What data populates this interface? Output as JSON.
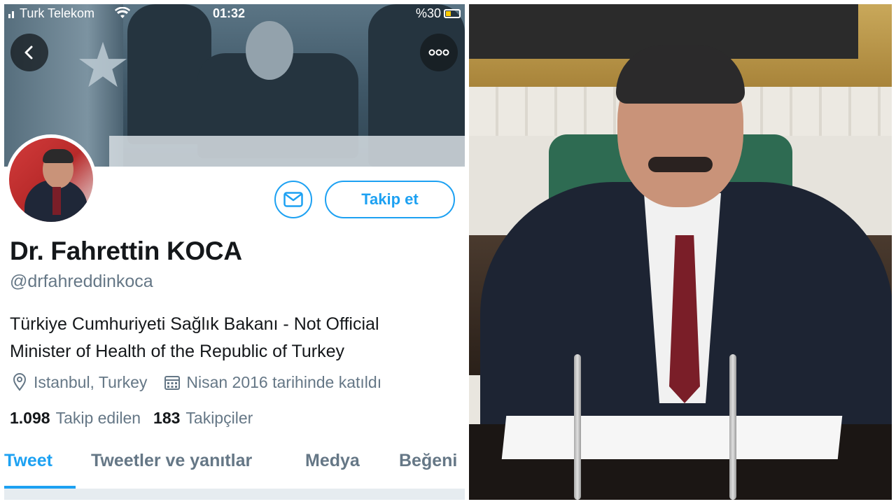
{
  "status_bar": {
    "carrier": "Turk Telekom",
    "time": "01:32",
    "battery": "%30"
  },
  "profile": {
    "name": "Dr. Fahrettin KOCA",
    "handle": "@drfahreddinkoca",
    "bio_line1": "Türkiye Cumhuriyeti Sağlık Bakanı - Not Official",
    "bio_line2": "Minister of Health of the Republic of Turkey",
    "location": "Istanbul, Turkey",
    "joined": "Nisan 2016 tarihinde katıldı",
    "following_count": "1.098",
    "following_label": "Takip edilen",
    "followers_count": "183",
    "followers_label": "Takipçiler",
    "follow_button": "Takip et"
  },
  "tabs": [
    {
      "label": "Tweet",
      "active": true
    },
    {
      "label": "Tweetler ve yanıtlar",
      "active": false
    },
    {
      "label": "Medya",
      "active": false
    },
    {
      "label": "Beğeni",
      "active": false
    }
  ],
  "icons": {
    "back": "back-arrow-icon",
    "more": "more-options-icon",
    "message": "envelope-icon",
    "location": "location-pin-icon",
    "calendar": "calendar-icon"
  },
  "colors": {
    "accent": "#1da1f2",
    "text_primary": "#14171a",
    "text_secondary": "#657786"
  }
}
